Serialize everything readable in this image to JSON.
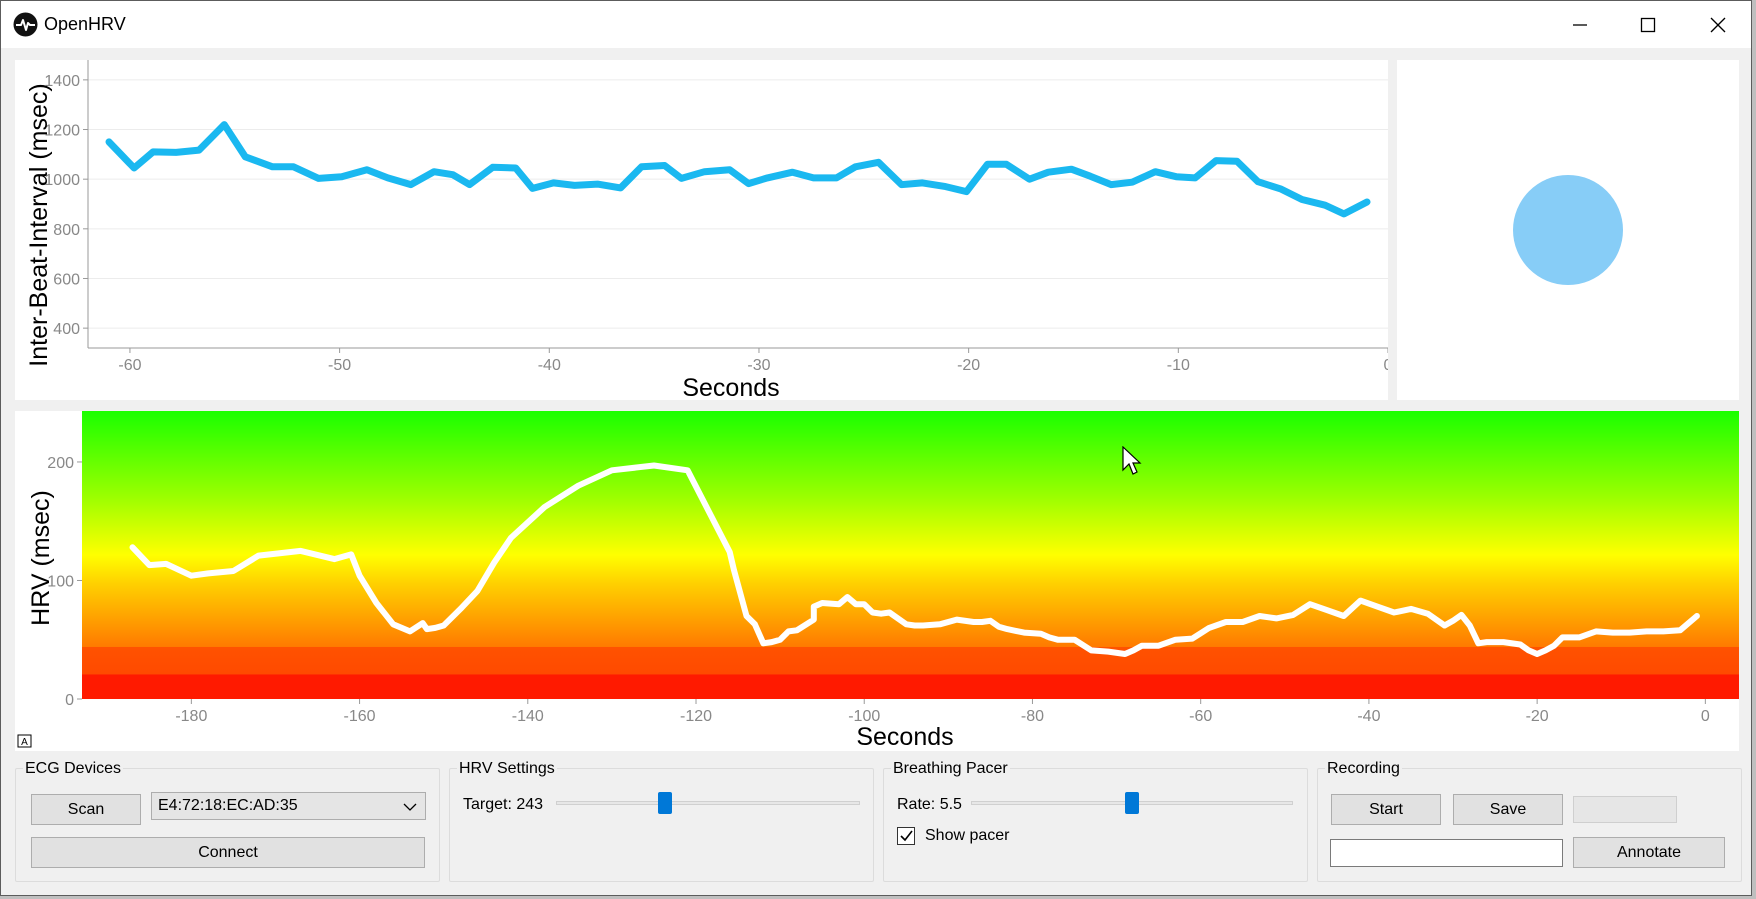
{
  "window": {
    "title": "OpenHRV"
  },
  "ibi_chart": {
    "chart_data": {
      "type": "line",
      "title": "",
      "xlabel": "Seconds",
      "ylabel": "Inter-Beat-Interval (msec)",
      "xlim": [
        -62,
        0
      ],
      "ylim": [
        320,
        1480
      ],
      "x_ticks": [
        -60,
        -50,
        -40,
        -30,
        -20,
        -10,
        0
      ],
      "y_ticks": [
        400,
        600,
        800,
        1000,
        1200,
        1400
      ],
      "grid": true,
      "line_color": "#1ab8f0",
      "series": [
        {
          "x": [
            -61.0,
            -59.8,
            -58.9,
            -57.8,
            -56.7,
            -55.5,
            -54.5,
            -53.2,
            -52.2,
            -51.0,
            -49.9,
            -48.7,
            -47.7,
            -46.6,
            -45.5,
            -44.6,
            -43.8,
            -42.7,
            -41.6,
            -40.8,
            -39.8,
            -38.8,
            -37.7,
            -36.6,
            -35.6,
            -34.5,
            -33.7,
            -32.6,
            -31.4,
            -30.5,
            -29.6,
            -28.4,
            -27.4,
            -26.3,
            -25.4,
            -24.3,
            -23.2,
            -22.2,
            -21.1,
            -20.1,
            -19.1,
            -18.2,
            -17.1,
            -16.2,
            -15.1,
            -14.2,
            -13.2,
            -12.2,
            -11.1,
            -10.1,
            -9.2,
            -8.2,
            -7.2,
            -6.2,
            -5.1,
            -4.1,
            -3.0,
            -2.1,
            -1.0
          ],
          "y": [
            1150,
            1045,
            1110,
            1108,
            1117,
            1220,
            1090,
            1050,
            1050,
            1003,
            1010,
            1038,
            1005,
            978,
            1030,
            1018,
            978,
            1048,
            1045,
            963,
            985,
            975,
            980,
            965,
            1050,
            1055,
            1003,
            1030,
            1038,
            982,
            1005,
            1028,
            1005,
            1005,
            1050,
            1068,
            978,
            985,
            970,
            950,
            1060,
            1060,
            1000,
            1028,
            1040,
            1012,
            978,
            988,
            1030,
            1010,
            1005,
            1075,
            1072,
            990,
            960,
            918,
            895,
            860,
            908,
            952
          ]
        }
      ]
    }
  },
  "pacer": {
    "circle_color": "#87cdf7"
  },
  "hrv_chart": {
    "chart_data": {
      "type": "line",
      "title": "",
      "xlabel": "Seconds",
      "ylabel": "HRV (msec)",
      "xlim": [
        -193,
        4
      ],
      "ylim": [
        0,
        243
      ],
      "x_ticks": [
        -180,
        -160,
        -140,
        -120,
        -100,
        -80,
        -60,
        -40,
        -20,
        0
      ],
      "y_ticks": [
        0,
        100,
        200
      ],
      "grid": false,
      "background": "gradient red-orange-yellow-green (bottom to top)",
      "line_color": "#ffffff",
      "series": [
        {
          "x": [
            -187,
            -185,
            -183,
            -180,
            -178,
            -175,
            -172,
            -167,
            -163,
            -161,
            -160,
            -158,
            -156,
            -154,
            -152.5,
            -152,
            -151,
            -150,
            -148,
            -146,
            -144,
            -142,
            -138,
            -134,
            -130,
            -125,
            -121,
            -116,
            -115.5,
            -114,
            -113,
            -112,
            -111,
            -110,
            -109,
            -108,
            -106,
            -106,
            -105,
            -103,
            -102,
            -101,
            -100,
            -99,
            -98,
            -97,
            -95,
            -94,
            -93,
            -91,
            -89,
            -87,
            -86,
            -85,
            -84,
            -83,
            -81,
            -79,
            -78,
            -77,
            -75,
            -73,
            -71,
            -69,
            -68,
            -67,
            -65,
            -63,
            -61,
            -59,
            -57,
            -55,
            -53,
            -51,
            -49,
            -47,
            -45,
            -43,
            -41,
            -39,
            -37,
            -35,
            -33,
            -31,
            -30,
            -29,
            -28,
            -27,
            -26,
            -26,
            -24,
            -22,
            -21,
            -20,
            -19,
            -18,
            -17,
            -15,
            -13,
            -13,
            -11,
            -9,
            -7,
            -5,
            -3,
            -1
          ],
          "y": [
            128,
            113,
            114,
            104,
            106,
            108,
            121,
            125,
            118,
            122,
            104,
            81,
            63,
            57,
            64,
            59,
            60,
            62,
            76,
            91,
            115,
            136,
            162,
            180,
            193,
            197,
            193,
            124,
            109,
            70,
            63,
            47,
            48,
            50,
            57,
            58,
            67,
            78,
            81,
            80,
            86,
            80,
            80,
            73,
            72,
            73,
            63,
            62,
            62,
            63,
            67,
            65,
            65,
            66,
            61,
            59,
            56,
            55,
            52,
            50,
            50,
            41,
            40,
            38,
            41,
            45,
            45,
            50,
            51,
            60,
            65,
            65,
            70,
            68,
            71,
            80,
            75,
            70,
            83,
            78,
            73,
            76,
            72,
            62,
            66,
            71,
            62,
            47,
            48,
            48,
            48,
            46,
            41,
            38,
            41,
            45,
            52,
            52,
            57,
            57,
            56,
            56,
            57,
            57,
            58,
            70
          ]
        }
      ]
    }
  },
  "ecg_devices": {
    "title": "ECG Devices",
    "scan_label": "Scan",
    "device_selected": "E4:72:18:EC:AD:35",
    "connect_label": "Connect"
  },
  "hrv_settings": {
    "title": "HRV Settings",
    "target_label": "Target: 243",
    "target_fraction": 0.36
  },
  "breathing_pacer": {
    "title": "Breathing Pacer",
    "rate_label": "Rate: 5.5",
    "rate_fraction": 0.5,
    "show_pacer_label": "Show pacer",
    "show_pacer_checked": true
  },
  "recording": {
    "title": "Recording",
    "start_label": "Start",
    "save_label": "Save",
    "annotation_value": "",
    "annotate_label": "Annotate"
  },
  "colors": {
    "accent": "#0078d7",
    "ibi_line": "#1ab8f0",
    "pacer_circle": "#87cdf7"
  }
}
